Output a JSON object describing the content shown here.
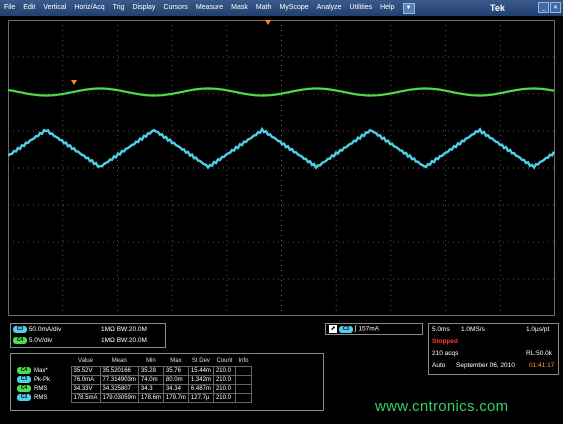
{
  "menu": {
    "items": [
      "File",
      "Edit",
      "Vertical",
      "Horiz/Acq",
      "Trig",
      "Display",
      "Cursors",
      "Measure",
      "Mask",
      "Math",
      "MyScope",
      "Analyze",
      "Utilities",
      "Help"
    ],
    "brand": "Tek"
  },
  "colors": {
    "ch_green": "#4cdc4c",
    "ch_cyan": "#4fd0e6",
    "trigger_orange": "#ff8a1c",
    "graticule": "#6a6a6a",
    "status_red": "#ff3b30",
    "menu_bg": "#2e4d80"
  },
  "channels": [
    {
      "badge": "C3",
      "scale": "50.0mA/div",
      "coupling": "1MΩ",
      "bw": "BW:20.0M",
      "color": "#4fd0e6"
    },
    {
      "badge": "C4",
      "scale": "5.0V/div",
      "coupling": "1MΩ",
      "bw": "BW:20.0M",
      "color": "#4cdc4c"
    }
  ],
  "trigger": {
    "badge": "C3",
    "level": "157mA",
    "slope_icon": "rising-edge-icon"
  },
  "timebase": {
    "scale": "5.0ms",
    "sample_rate": "1.0MS/s",
    "resolution": "1.0µs/pt",
    "status": "Stopped",
    "acqs": "210 acqs",
    "record_length": "RL:50.0k",
    "mode": "Auto",
    "date": "September 06, 2010",
    "time": "01:41:17"
  },
  "measurements": {
    "headers": [
      "Value",
      "Mean",
      "Min",
      "Max",
      "St Dev",
      "Count",
      "Info"
    ],
    "rows": [
      {
        "badge": "C4",
        "name": "Max*",
        "cells": [
          "35.52V",
          "35.520166",
          "35.28",
          "35.76",
          "15.44m",
          "210.0",
          ""
        ]
      },
      {
        "badge": "C3",
        "name": "Pk-Pk",
        "cells": [
          "76.0mA",
          "77.314903m",
          "74.0m",
          "80.0m",
          "1.342m",
          "210.0",
          ""
        ]
      },
      {
        "badge": "C4",
        "name": "RMS",
        "cells": [
          "34.33V",
          "34.325807",
          "34.3",
          "34.34",
          "6.487m",
          "210.0",
          ""
        ]
      },
      {
        "badge": "C3",
        "name": "RMS",
        "cells": [
          "178.5mA",
          "179.03059m",
          "178.6m",
          "179.7m",
          "127.7µ",
          "210.0",
          ""
        ]
      }
    ]
  },
  "watermark": "www.cntronics.com"
}
